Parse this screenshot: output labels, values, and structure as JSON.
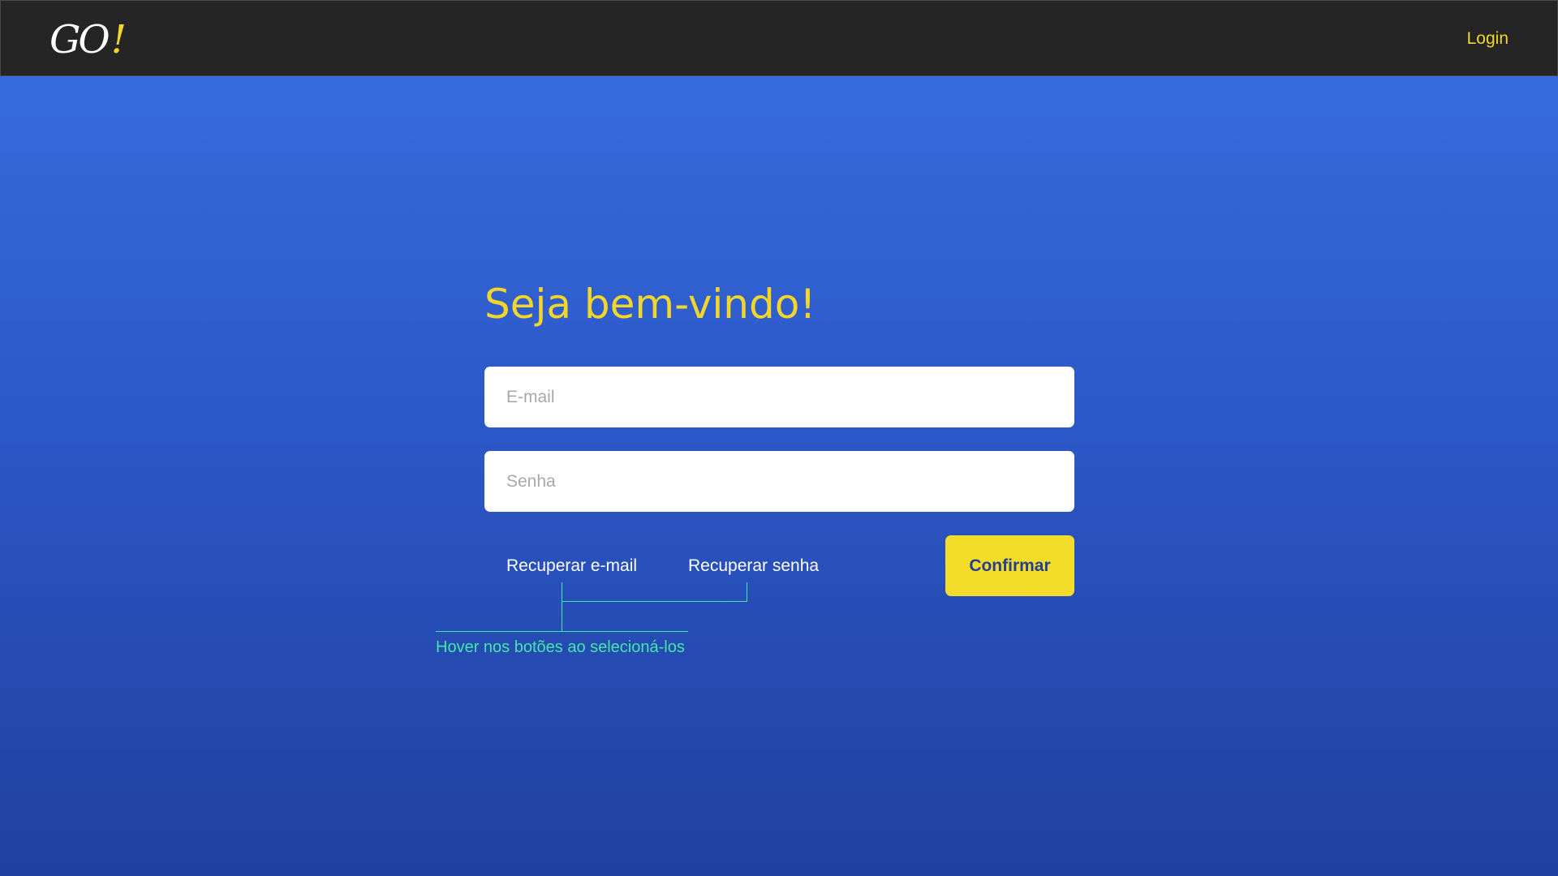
{
  "header": {
    "logo_text": "GO",
    "logo_bang": "!",
    "login_label": "Login"
  },
  "main": {
    "title": "Seja bem-vindo!",
    "email_placeholder": "E-mail",
    "password_placeholder": "Senha",
    "recover_email_label": "Recuperar e-mail",
    "recover_password_label": "Recuperar senha",
    "confirm_label": "Confirmar"
  },
  "annotation": {
    "text": "Hover nos botões ao selecioná-los"
  },
  "colors": {
    "accent": "#f3d62a",
    "header_bg": "#252525",
    "background_top": "#396fe0",
    "background_bottom": "#1f40a0",
    "annotation": "#44e6a8",
    "confirm_text": "#233f93"
  }
}
